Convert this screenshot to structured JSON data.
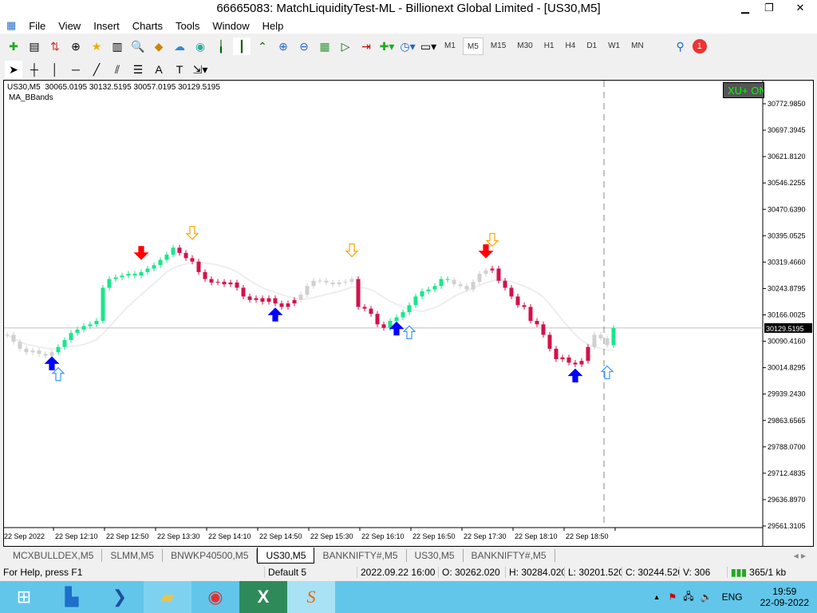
{
  "window": {
    "title": "66665083: MatchLiquidityTest-ML - Billionext Global Limited - [US30,M5]"
  },
  "menu": [
    "File",
    "View",
    "Insert",
    "Charts",
    "Tools",
    "Window",
    "Help"
  ],
  "timeframes": [
    "M1",
    "M5",
    "M15",
    "M30",
    "H1",
    "H4",
    "D1",
    "W1",
    "MN"
  ],
  "selected_timeframe": "M5",
  "notification_count": "1",
  "chart": {
    "info": "US30,M5  30065.0195 30132.5195 30057.0195 30129.5195",
    "indicator": "MA_BBands",
    "ea_label": "XU+ ON",
    "last_price": "30129.5195",
    "colors": {
      "bull": "#19e68c",
      "bear": "#d3124a",
      "neutral": "#d0d0d0",
      "buy_arrow": "#0000ff",
      "sell_arrow": "#ff0000",
      "hollow_up": "#3399ff",
      "hollow_down": "#ffa500"
    }
  },
  "chart_data": {
    "type": "candlestick",
    "symbol": "US30",
    "timeframe": "M5",
    "ylim": [
      29561.3105,
      30772.985
    ],
    "y_ticks": [
      "30772.9850",
      "30697.3945",
      "30621.8120",
      "30546.2255",
      "30470.6390",
      "30395.0525",
      "30319.4660",
      "30243.8795",
      "30166.0025",
      "30090.4160",
      "30014.8295",
      "29939.2430",
      "29863.6565",
      "29788.0700",
      "29712.4835",
      "29636.8970",
      "29561.3105"
    ],
    "x_ticks": [
      "22 Sep 2022",
      "22 Sep 12:10",
      "22 Sep 12:50",
      "22 Sep 13:30",
      "22 Sep 14:10",
      "22 Sep 14:50",
      "22 Sep 15:30",
      "22 Sep 16:10",
      "22 Sep 16:50",
      "22 Sep 17:30",
      "22 Sep 18:10",
      "22 Sep 18:50"
    ],
    "closes": [
      30110,
      30090,
      30070,
      30060,
      30065,
      30055,
      30050,
      30060,
      30075,
      30095,
      30115,
      30125,
      30135,
      30140,
      30150,
      30245,
      30270,
      30275,
      30280,
      30285,
      30280,
      30290,
      30300,
      30310,
      30325,
      30340,
      30360,
      30345,
      30330,
      30320,
      30290,
      30270,
      30260,
      30262,
      30255,
      30260,
      30245,
      30220,
      30210,
      30215,
      30205,
      30215,
      30200,
      30190,
      30200,
      30210,
      30225,
      30250,
      30265,
      30265,
      30260,
      30255,
      30260,
      30262,
      30270,
      30190,
      30185,
      30170,
      30140,
      30130,
      30150,
      30160,
      30175,
      30195,
      30220,
      30235,
      30240,
      30250,
      30270,
      30268,
      30255,
      30250,
      30240,
      30262,
      30285,
      30295,
      30300,
      30265,
      30245,
      30220,
      30195,
      30190,
      30150,
      30140,
      30110,
      30070,
      30040,
      30045,
      30030,
      30025,
      30035,
      30075,
      30110,
      30100,
      30080,
      30129.5
    ],
    "color_segments": [
      {
        "from": 0,
        "to": 7,
        "c": "neutral"
      },
      {
        "from": 8,
        "to": 26,
        "c": "bull"
      },
      {
        "from": 27,
        "to": 45,
        "c": "bear"
      },
      {
        "from": 46,
        "to": 54,
        "c": "neutral"
      },
      {
        "from": 55,
        "to": 59,
        "c": "bear"
      },
      {
        "from": 60,
        "to": 69,
        "c": "bull"
      },
      {
        "from": 70,
        "to": 75,
        "c": "neutral"
      },
      {
        "from": 76,
        "to": 91,
        "c": "bear"
      },
      {
        "from": 92,
        "to": 94,
        "c": "neutral"
      },
      {
        "from": 95,
        "to": 95,
        "c": "bull"
      }
    ],
    "arrows": [
      {
        "i": 7,
        "t": "buy"
      },
      {
        "i": 8,
        "t": "hollow_up"
      },
      {
        "i": 21,
        "t": "sell"
      },
      {
        "i": 29,
        "t": "hollow_down"
      },
      {
        "i": 42,
        "t": "buy"
      },
      {
        "i": 54,
        "t": "hollow_down"
      },
      {
        "i": 61,
        "t": "buy"
      },
      {
        "i": 63,
        "t": "hollow_up"
      },
      {
        "i": 75,
        "t": "sell"
      },
      {
        "i": 76,
        "t": "hollow_down"
      },
      {
        "i": 89,
        "t": "buy"
      },
      {
        "i": 94,
        "t": "hollow_up"
      }
    ]
  },
  "tabs": [
    "MCXBULLDEX,M5",
    "SLMM,M5",
    "BNWKP40500,M5",
    "US30,M5",
    "BANKNIFTY#,M5",
    "US30,M5",
    "BANKNIFTY#,M5"
  ],
  "active_tab": 3,
  "status": {
    "help": "For Help, press F1",
    "profile": "Default 5",
    "datetime": "2022.09.22 16:00",
    "open": "O: 30262.020",
    "high": "H: 30284.020",
    "low": "L: 30201.520",
    "close": "C: 30244.520",
    "volume": "V: 306",
    "traffic": "365/1 kb"
  },
  "taskbar": {
    "lang": "ENG",
    "time": "19:59",
    "date": "22-09-2022"
  }
}
